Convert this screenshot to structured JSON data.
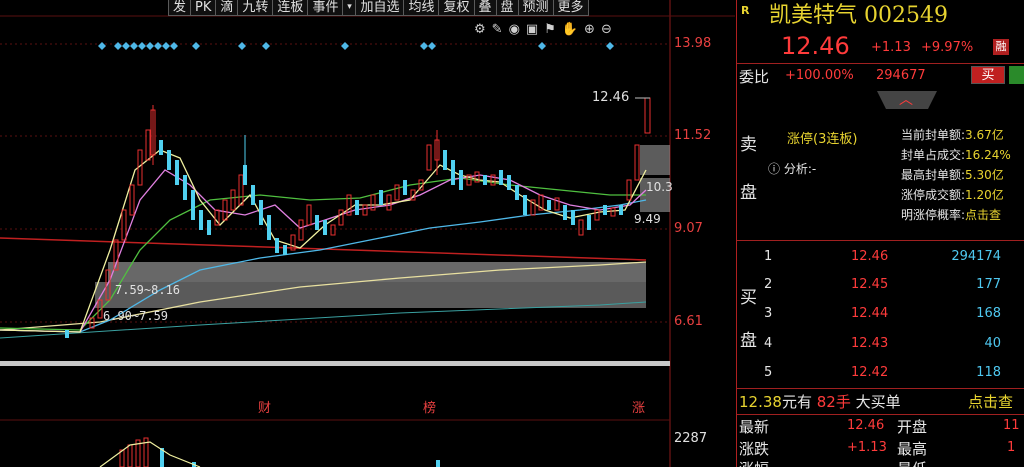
{
  "toolbar": {
    "items": [
      "发",
      "PK",
      "滴",
      "九转",
      "连板",
      "事件",
      "▾",
      "加自选",
      "均线",
      "复权",
      "叠",
      "盘",
      "预测",
      "更多"
    ]
  },
  "chart": {
    "price_axis": [
      "13.98",
      "11.52",
      "9.07",
      "6.61"
    ],
    "volume_axis": "2287",
    "annotations": {
      "high": "12.46",
      "right_10": "10.3",
      "right_949": "9.49",
      "zone1": "7.59~8.16",
      "zone2": "6.90~7.59"
    },
    "markers": [
      "财",
      "榜",
      "涨"
    ],
    "icons": [
      "gear-icon",
      "pen-icon",
      "eye-icon",
      "lock-icon",
      "flag-icon",
      "hand-icon",
      "zoom-in-icon",
      "zoom-out-icon"
    ]
  },
  "stock": {
    "flag": "R",
    "name": "凯美特气",
    "code": "002549",
    "price": "12.46",
    "change": "+1.13",
    "change_pct": "+9.97%",
    "badge": "融"
  },
  "order": {
    "weibi_label": "委比",
    "weibi_value": "+100.00%",
    "weibi_count": "294677",
    "buy_btn": "买",
    "sell_label": "卖",
    "sell_label2": "盘",
    "buy_label": "买",
    "buy_label2": "盘",
    "limit_up": "涨停(3连板)",
    "analysis": "分析:-",
    "stats": [
      {
        "label": "当前封单额:",
        "value": "3.67亿"
      },
      {
        "label": "封单占成交:",
        "value": "16.24%"
      },
      {
        "label": "最高封单额:",
        "value": "5.30亿"
      },
      {
        "label": "涨停成交额:",
        "value": "1.20亿"
      },
      {
        "label": "明涨停概率:",
        "value": "点击查"
      }
    ],
    "bids": [
      {
        "level": "1",
        "price": "12.46",
        "vol": "294174"
      },
      {
        "level": "2",
        "price": "12.45",
        "vol": "177"
      },
      {
        "level": "3",
        "price": "12.44",
        "vol": "168"
      },
      {
        "level": "4",
        "price": "12.43",
        "vol": "40"
      },
      {
        "level": "5",
        "price": "12.42",
        "vol": "118"
      }
    ]
  },
  "bigorder": {
    "price": "12.38",
    "unit": "元有",
    "qty": "82手",
    "label": "大买单",
    "action": "点击查"
  },
  "quote": {
    "latest_label": "最新",
    "latest": "12.46",
    "open_label": "开盘",
    "open": "11",
    "change_label": "涨跌",
    "change": "+1.13",
    "high_label": "最高",
    "high": "1",
    "row3_label": "涨幅",
    "row3_label2": "最低"
  }
}
